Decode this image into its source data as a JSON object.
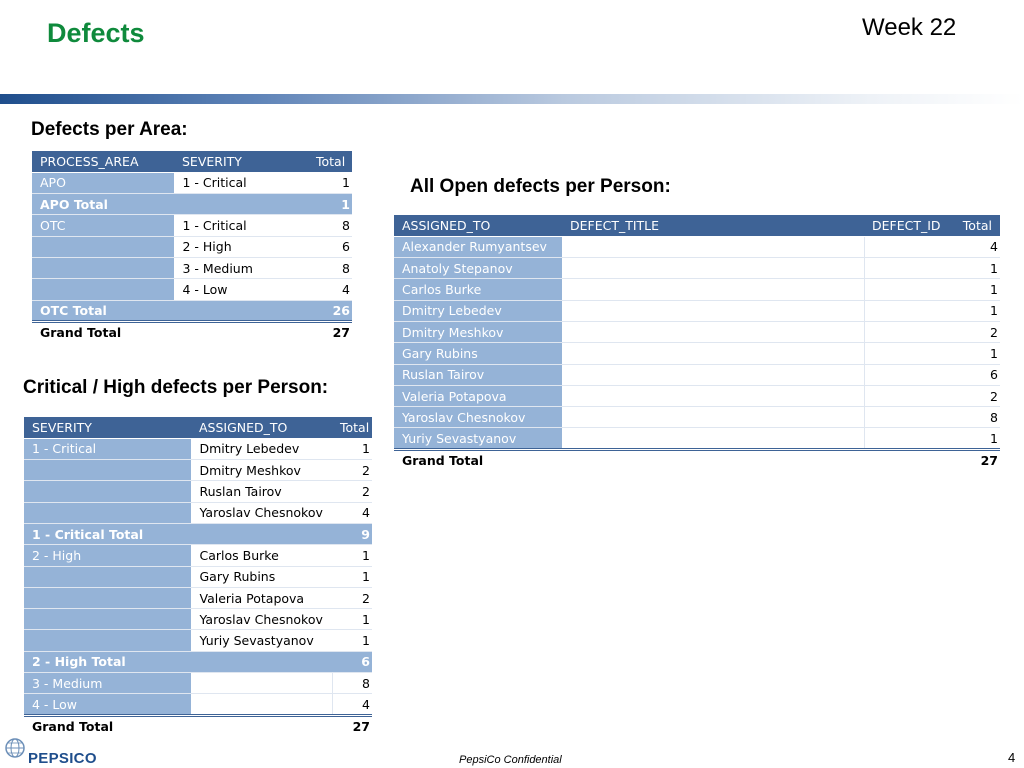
{
  "slide": {
    "title": "Defects",
    "week": "Week 22",
    "footer": "PepsiCo Confidential",
    "page_number": "4",
    "logo_text": "PEPSICO"
  },
  "area": {
    "heading": "Defects per Area:",
    "headers": [
      "PROCESS_AREA",
      "SEVERITY",
      "Total"
    ],
    "apo": {
      "label": "APO",
      "rows": [
        {
          "severity": "1 - Critical",
          "total": "1"
        }
      ],
      "total_label": "APO Total",
      "total": "1"
    },
    "otc": {
      "label": "OTC",
      "rows": [
        {
          "severity": "1 - Critical",
          "total": "8"
        },
        {
          "severity": "2 - High",
          "total": "6"
        },
        {
          "severity": "3 - Medium",
          "total": "8"
        },
        {
          "severity": "4 - Low",
          "total": "4"
        }
      ],
      "total_label": "OTC Total",
      "total": "26"
    },
    "grand_label": "Grand Total",
    "grand_total": "27"
  },
  "critical": {
    "heading": "Critical / High defects per Person:",
    "headers": [
      "SEVERITY",
      "ASSIGNED_TO",
      "Total"
    ],
    "crit": {
      "label": "1 - Critical",
      "rows": [
        {
          "person": "Dmitry Lebedev",
          "total": "1"
        },
        {
          "person": "Dmitry Meshkov",
          "total": "2"
        },
        {
          "person": "Ruslan Tairov",
          "total": "2"
        },
        {
          "person": "Yaroslav Chesnokov",
          "total": "4"
        }
      ],
      "total_label": "1 - Critical Total",
      "total": "9"
    },
    "high": {
      "label": "2 - High",
      "rows": [
        {
          "person": "Carlos Burke",
          "total": "1"
        },
        {
          "person": "Gary Rubins",
          "total": "1"
        },
        {
          "person": "Valeria Potapova",
          "total": "2"
        },
        {
          "person": "Yaroslav Chesnokov",
          "total": "1"
        },
        {
          "person": "Yuriy Sevastyanov",
          "total": "1"
        }
      ],
      "total_label": "2 - High Total",
      "total": "6"
    },
    "medium": {
      "label": "3 - Medium",
      "total": "8"
    },
    "low": {
      "label": "4 - Low",
      "total": "4"
    },
    "grand_label": "Grand Total",
    "grand_total": "27"
  },
  "open": {
    "heading": "All Open defects per Person:",
    "headers": [
      "ASSIGNED_TO",
      "DEFECT_TITLE",
      "DEFECT_ID",
      "Total"
    ],
    "rows": [
      {
        "person": "Alexander Rumyantsev",
        "total": "4"
      },
      {
        "person": "Anatoly Stepanov",
        "total": "1"
      },
      {
        "person": "Carlos Burke",
        "total": "1"
      },
      {
        "person": "Dmitry Lebedev",
        "total": "1"
      },
      {
        "person": "Dmitry Meshkov",
        "total": "2"
      },
      {
        "person": "Gary Rubins",
        "total": "1"
      },
      {
        "person": "Ruslan Tairov",
        "total": "6"
      },
      {
        "person": "Valeria Potapova",
        "total": "2"
      },
      {
        "person": "Yaroslav Chesnokov",
        "total": "8"
      },
      {
        "person": "Yuriy Sevastyanov",
        "total": "1"
      }
    ],
    "grand_label": "Grand Total",
    "grand_total": "27"
  }
}
